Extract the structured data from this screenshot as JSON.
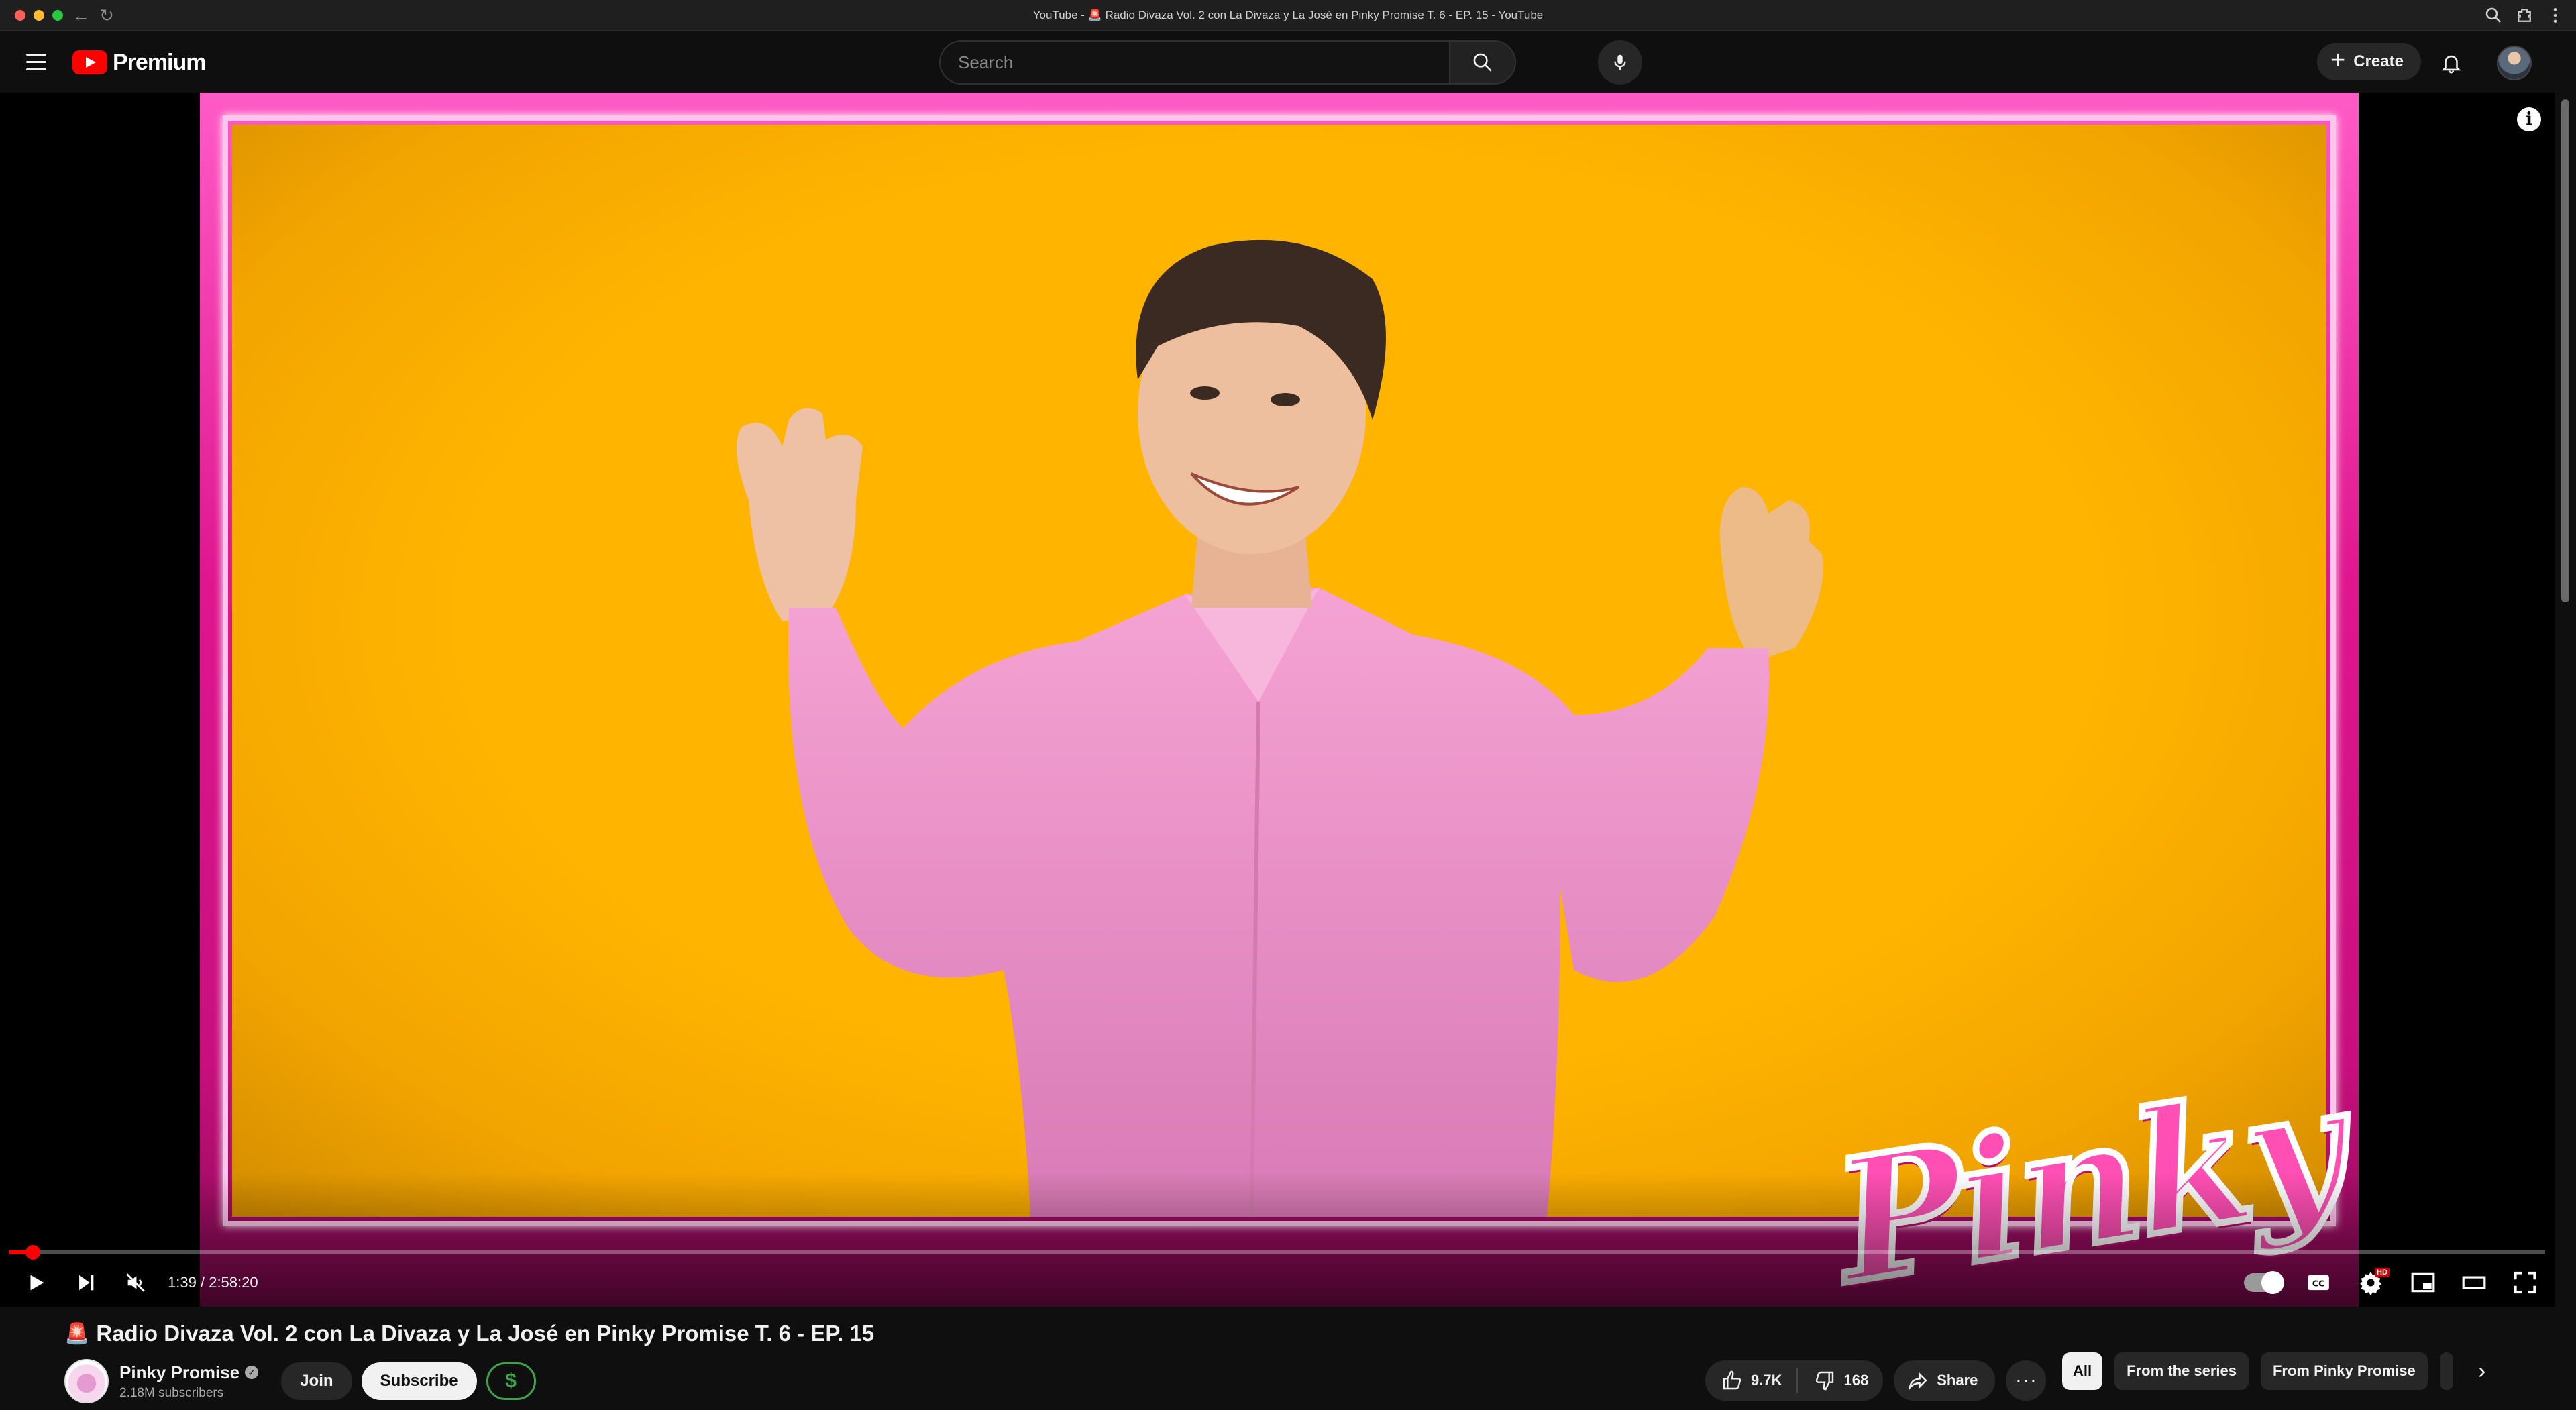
{
  "browser": {
    "tab_title": "YouTube - 🚨 Radio Divaza Vol. 2 con La Divaza y La José en Pinky Promise T. 6 - EP. 15 - YouTube"
  },
  "masthead": {
    "logo_text": "Premium",
    "search_placeholder": "Search",
    "create_label": "Create"
  },
  "player": {
    "current_time": "1:39",
    "duration": "2:58:20",
    "time_separator": "/",
    "progress_fraction": 0.0093,
    "overlay_logo": "Pinky",
    "hd_badge": "HD",
    "info_glyph": "i"
  },
  "video": {
    "title_emoji": "🚨",
    "title": "Radio Divaza Vol. 2 con La Divaza y La José en Pinky Promise T. 6 - EP. 15",
    "channel_name": "Pinky Promise",
    "verified_glyph": "✓",
    "subscribers": "2.18M subscribers",
    "join_label": "Join",
    "subscribe_label": "Subscribe",
    "dollar_glyph": "$",
    "likes": "9.7K",
    "dislikes": "168",
    "share_label": "Share",
    "more_glyph": "···"
  },
  "chips": {
    "items": [
      "All",
      "From the series",
      "From Pinky Promise"
    ],
    "next_glyph": "›"
  },
  "colors": {
    "brand_red": "#ff0000",
    "frame_pink": "#e0168f",
    "stage_yellow": "#ffb400",
    "membership_green": "#3fa34d"
  }
}
